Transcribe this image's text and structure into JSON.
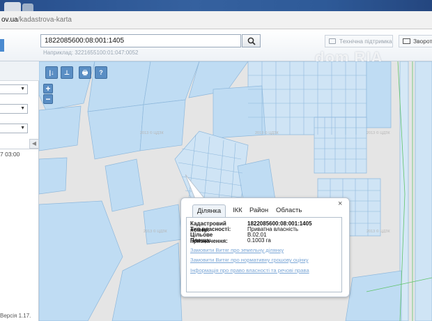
{
  "browser": {
    "url_host": "ov.ua",
    "url_path": "/kadastrova-karta"
  },
  "header": {
    "search_value": "1822085600:08:001:1405",
    "search_hint": "Наприклад: 3221655100:01:047:0052",
    "support_label": "Технічна підтримка",
    "feedback_label": "Зворот",
    "watermark": "dom RIA"
  },
  "sidebar": {
    "time_text": "7 03:00",
    "version_text": "Версія 1.17.",
    "collapse_glyph": "◀"
  },
  "map": {
    "tools": [
      "|↓",
      "⊥",
      "🖶",
      "?"
    ],
    "zoom_in": "+",
    "zoom_out": "−",
    "map_watermark": "2013 © ЦДЗК"
  },
  "popup": {
    "close_glyph": "×",
    "tabs": [
      {
        "label": "Ділянка",
        "active": true
      },
      {
        "label": "ІКК",
        "active": false
      },
      {
        "label": "Район",
        "active": false
      },
      {
        "label": "Область",
        "active": false
      }
    ],
    "fields": [
      {
        "label": "Кадастровий номер:",
        "value": "1822085600:08:001:1405"
      },
      {
        "label": "Тип власності:",
        "value": "Приватна власність"
      },
      {
        "label": "Цільове призначення:",
        "value": "В.02.01"
      },
      {
        "label": "Площа:",
        "value": "0.1003 га"
      }
    ],
    "links": [
      "Замовити Витяг про земельну ділянку",
      "Замовити Витяг про нормативну грошову оцінку",
      "Інформація про право власності та речові права"
    ]
  },
  "colors": {
    "parcel_fill": "#bfdcf3",
    "parcel_stroke": "#8eb8dc",
    "map_bg": "#e5e5e5",
    "link": "#7aa6d6",
    "tool_blue": "#5a8ec4"
  }
}
